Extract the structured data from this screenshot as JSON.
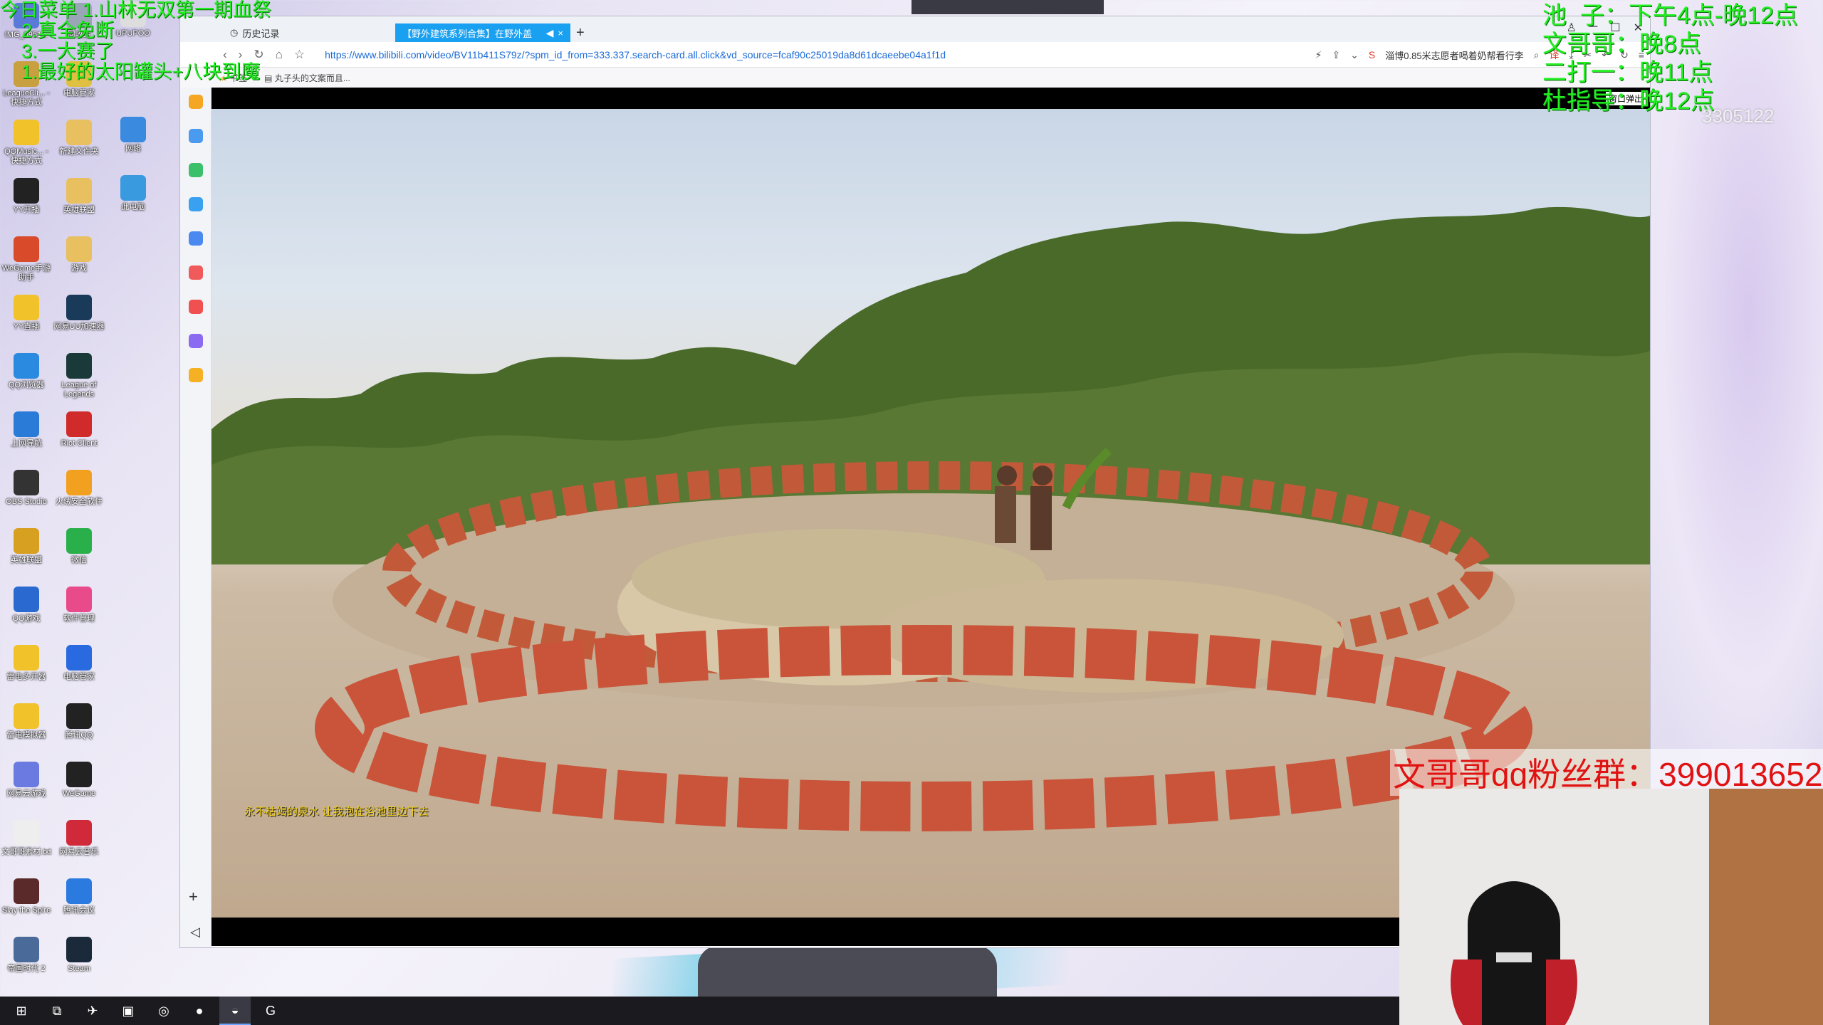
{
  "overlay": {
    "top_left": "今日菜单 1.山林无双第一期血祭\n    2.真全免断\n    3.一大赛了\n    1.最好的太阳罐头+八块到魔",
    "schedule": "池  子：下午4点-晚12点\n文哥哥：晚8点\n二打一：晚11点\n杜指导：晚12点",
    "room_number": "3305122",
    "qq_group": "文哥哥qq粉丝群：399013652"
  },
  "desktop": {
    "icons": [
      {
        "label": "IMG_0951...",
        "color": "#5a7ad8"
      },
      {
        "label": "LeagueCli... - 快捷方式",
        "color": "#c8a040"
      },
      {
        "label": "QQMusic... - 快捷方式",
        "color": "#f2c22a"
      },
      {
        "label": "YY开播",
        "color": "#222"
      },
      {
        "label": "WeGame手游助手",
        "color": "#d84a2a"
      },
      {
        "label": "YY直播",
        "color": "#f2c22a"
      },
      {
        "label": "QQ浏览器",
        "color": "#2a8ae0"
      },
      {
        "label": "上网导航",
        "color": "#2a7ad8"
      },
      {
        "label": "OBS Studio",
        "color": "#333"
      },
      {
        "label": "英雄联盟",
        "color": "#d8a020"
      },
      {
        "label": "QQ游戏",
        "color": "#2a6ad0"
      },
      {
        "label": "雷电多开器",
        "color": "#f2c22a"
      },
      {
        "label": "雷电模拟器",
        "color": "#f2c22a"
      },
      {
        "label": "网易云游戏",
        "color": "#6a7ae0"
      },
      {
        "label": "文哥哥素材.txt",
        "color": "#eee"
      },
      {
        "label": "Slay the Spire",
        "color": "#5a2a2a"
      },
      {
        "label": "帝国时代 2",
        "color": "#4a6a9a"
      },
      {
        "label": "回收站",
        "color": "#9aa6b6"
      },
      {
        "label": "电脑管家",
        "color": "#e0c040"
      },
      {
        "label": "新建文件夹",
        "color": "#e8c060"
      },
      {
        "label": "英雄联盟",
        "color": "#e8c060"
      },
      {
        "label": "游戏",
        "color": "#e8c060"
      },
      {
        "label": "网易UU加速器",
        "color": "#1a3a5a"
      },
      {
        "label": "League of Legends",
        "color": "#1a3a3a"
      },
      {
        "label": "Riot Client",
        "color": "#d02a2a"
      },
      {
        "label": "火绒安全软件",
        "color": "#f2a020"
      },
      {
        "label": "微信",
        "color": "#2ab04a"
      },
      {
        "label": "软件管理",
        "color": "#e84a8a"
      },
      {
        "label": "电脑管家",
        "color": "#2a6ae0"
      },
      {
        "label": "腾讯QQ",
        "color": "#222"
      },
      {
        "label": "WeGame",
        "color": "#222"
      },
      {
        "label": "网易云音乐",
        "color": "#d02a3a"
      },
      {
        "label": "腾讯会议",
        "color": "#2a7ae0"
      },
      {
        "label": "Steam",
        "color": "#1a2a3a"
      },
      {
        "label": "UPUPOO",
        "color": "#ddd"
      },
      {
        "label": "网络",
        "color": "#3a8ae0"
      },
      {
        "label": "此电脑",
        "color": "#3a9ae0"
      }
    ]
  },
  "browser": {
    "tabs": [
      {
        "label": "历史记录"
      },
      {
        "label": "【野外建筑系列合集】在野外盖"
      }
    ],
    "url": "https://www.bilibili.com/video/BV11b411S79z/?spm_id_from=333.337.search-card.all.click&vd_source=fcaf90c25019da8d61dcaeebe04a1f1d",
    "search_text": "淄博0.85米志愿者喝着奶帮看行李",
    "bookmarks": [
      {
        "label": "书签"
      },
      {
        "label": "丸子头的文案而且..."
      }
    ],
    "video": {
      "subtitle": "永不枯竭的泉水 让我泡在浴池里边下去",
      "exit_label": "窗口弹出"
    }
  },
  "taskbar": {
    "items": [
      {
        "name": "start-button",
        "glyph": "⊞"
      },
      {
        "name": "task-view",
        "glyph": "⧉"
      },
      {
        "name": "app-pin",
        "glyph": "✈"
      },
      {
        "name": "app-file",
        "glyph": "▣"
      },
      {
        "name": "app-yy",
        "glyph": "◎"
      },
      {
        "name": "app-wechat",
        "glyph": "●"
      },
      {
        "name": "app-browser",
        "glyph": "◒"
      },
      {
        "name": "app-g",
        "glyph": "G"
      }
    ]
  }
}
